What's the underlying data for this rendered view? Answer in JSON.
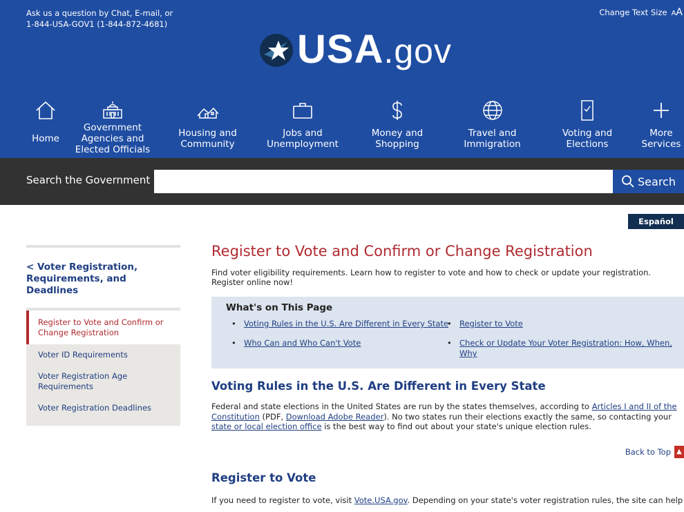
{
  "header": {
    "contact_line1": "Ask us a question by Chat, E-mail, or",
    "contact_line2": "1-844-USA-GOV1 (1-844-872-4681)",
    "change_text_size": "Change Text Size",
    "text_size_small": "A",
    "text_size_large": "A",
    "logo_main": "USA",
    "logo_suffix": ".gov"
  },
  "nav": [
    {
      "label": "Home",
      "icon": "home-icon"
    },
    {
      "label": "Government Agencies and Elected Officials",
      "icon": "capitol-icon"
    },
    {
      "label": "Housing and Community",
      "icon": "houses-icon"
    },
    {
      "label": "Jobs and Unemployment",
      "icon": "briefcase-icon"
    },
    {
      "label": "Money and Shopping",
      "icon": "dollar-icon"
    },
    {
      "label": "Travel and Immigration",
      "icon": "globe-icon"
    },
    {
      "label": "Voting and Elections",
      "icon": "ballot-icon"
    },
    {
      "label": "More Services",
      "icon": "plus-icon"
    }
  ],
  "search": {
    "label": "Search the Government",
    "value": "",
    "button": "Search"
  },
  "espanol": "Español",
  "sidebar": {
    "back": "< Voter Registration, Requirements, and Deadlines",
    "items": [
      {
        "label": "Register to Vote and Confirm or Change Registration",
        "active": true
      },
      {
        "label": "Voter ID Requirements"
      },
      {
        "label": "Voter Registration Age Requirements"
      },
      {
        "label": "Voter Registration Deadlines"
      }
    ]
  },
  "main": {
    "title": "Register to Vote and Confirm or Change Registration",
    "intro": "Find voter eligibility requirements. Learn how to register to vote and how to check or update your registration. Register online now!",
    "toc": {
      "title": "What's on This Page",
      "links": [
        "Voting Rules in the U.S. Are Different in Every State",
        "Register to Vote",
        "Who Can and Who Can't Vote",
        "Check or Update Your Voter Registration: How, When, Why"
      ]
    },
    "section1": {
      "heading": "Voting Rules in the U.S. Are Different in Every State",
      "text_a": "Federal and state elections in the United States are run by the states themselves, according to ",
      "link_a": "Articles I and II of the Constitution",
      "text_b": " (PDF, ",
      "link_b": "Download Adobe Reader",
      "text_c": "). No two states run their elections exactly the same, so contacting your ",
      "link_c": "state or local election office",
      "text_d": " is the best way to find out about your state's unique election rules."
    },
    "back_to_top": "Back to Top",
    "section2": {
      "heading": "Register to Vote",
      "text_a": "If you need to register to vote, visit ",
      "link_a": "Vote.USA.gov",
      "text_b": ". Depending on your state's voter registration rules, the site can help you"
    }
  }
}
